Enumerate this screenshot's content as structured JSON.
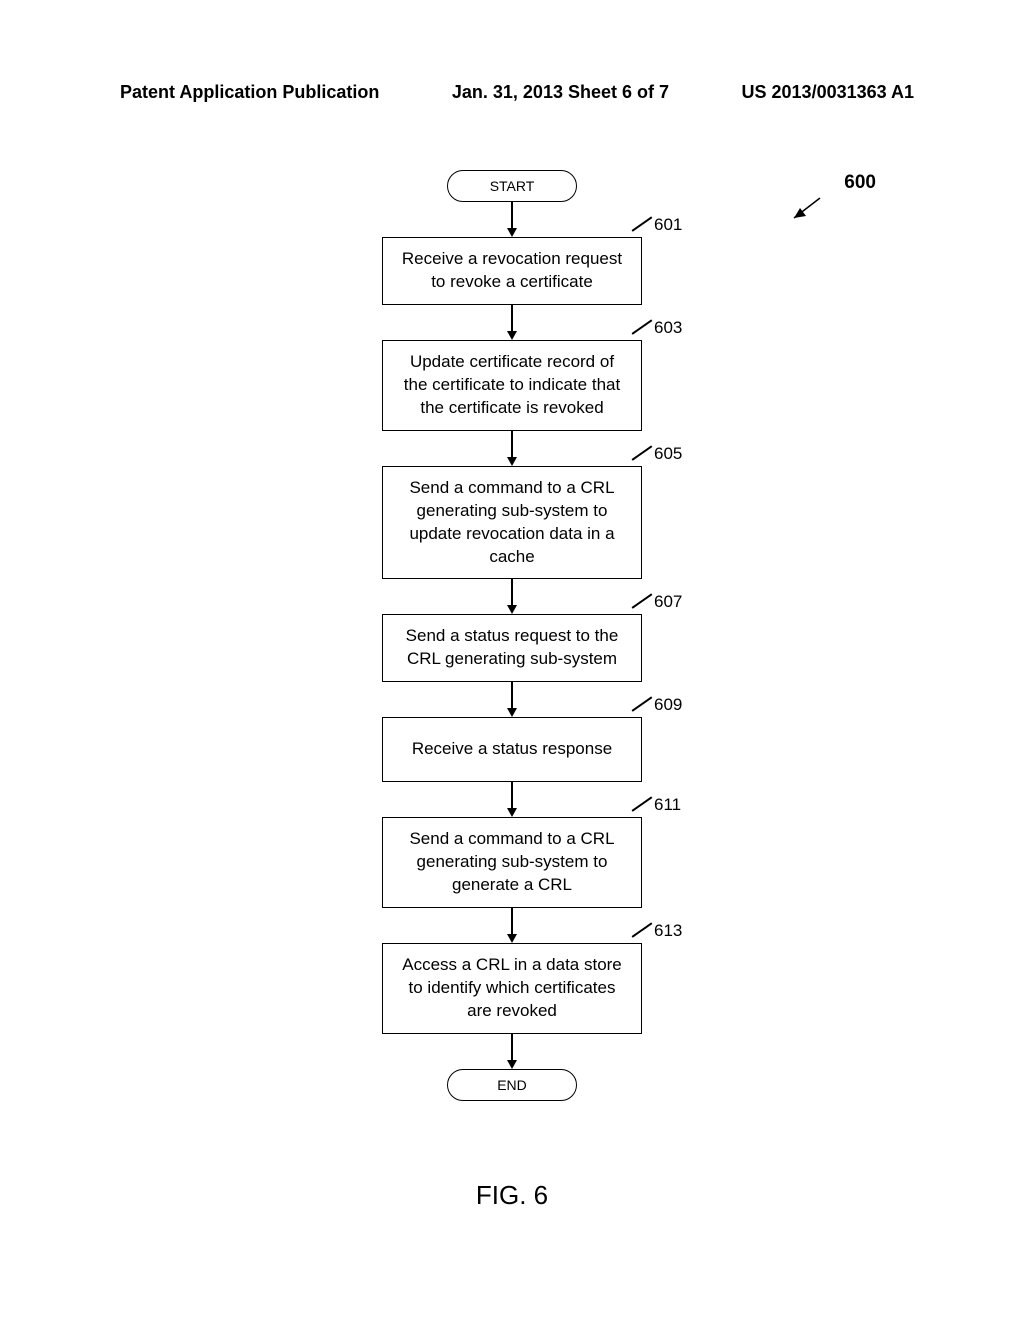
{
  "header": {
    "left": "Patent Application Publication",
    "center": "Jan. 31, 2013  Sheet 6 of 7",
    "right": "US 2013/0031363 A1"
  },
  "ref600": "600",
  "terminals": {
    "start": "START",
    "end": "END"
  },
  "steps": [
    {
      "num": "601",
      "text": "Receive a revocation request to revoke a certificate"
    },
    {
      "num": "603",
      "text": "Update certificate record of the certificate to indicate that the certificate is revoked"
    },
    {
      "num": "605",
      "text": "Send a command to a CRL generating sub-system to update revocation data in a cache"
    },
    {
      "num": "607",
      "text": "Send a status request to the CRL generating sub-system"
    },
    {
      "num": "609",
      "text": "Receive a status response"
    },
    {
      "num": "611",
      "text": "Send a command to a CRL generating sub-system to generate a CRL"
    },
    {
      "num": "613",
      "text": "Access a CRL in a data store to identify which certificates are revoked"
    }
  ],
  "figure_label": "FIG. 6"
}
